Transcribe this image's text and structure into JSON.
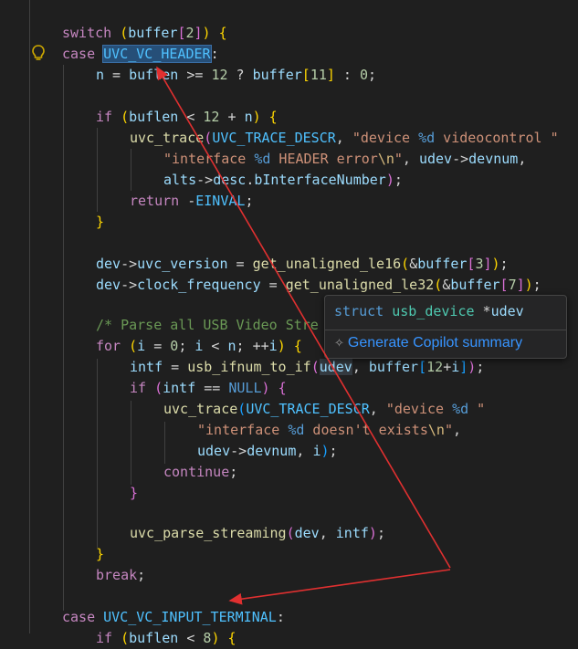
{
  "code": {
    "l1": {
      "a": "switch",
      "b": "(",
      "c": "buffer",
      "d": "[",
      "e": "2",
      "f": "]",
      "g": ")",
      "h": "{"
    },
    "l2": {
      "a": "case",
      "b": "UVC_VC_HEADER",
      "c": ":"
    },
    "l3": {
      "a": "n",
      "b": " = ",
      "c": "buflen",
      "d": " >= ",
      "e": "12",
      "f": " ? ",
      "g": "buffer",
      "h": "[",
      "i": "11",
      "j": "]",
      "k": " : ",
      "l": "0",
      "m": ";"
    },
    "l5": {
      "a": "if",
      "b": "(",
      "c": "buflen",
      "d": " < ",
      "e": "12",
      "f": " + ",
      "g": "n",
      "h": ")",
      "i": "{"
    },
    "l6": {
      "a": "uvc_trace",
      "b": "(",
      "c": "UVC_TRACE_DESCR",
      "d": ", ",
      "e": "\"device ",
      "f": "%d",
      "g": " videocontrol \""
    },
    "l7": {
      "a": "\"interface ",
      "b": "%d",
      "c": " HEADER error",
      "d": "\\n",
      "e": "\"",
      "f": ", ",
      "g": "udev",
      "h": "->",
      "i": "devnum",
      "j": ","
    },
    "l8": {
      "a": "alts",
      "b": "->",
      "c": "desc",
      "d": ".",
      "e": "bInterfaceNumber",
      "f": ")",
      "g": ";"
    },
    "l9": {
      "a": "return",
      "b": " -",
      "c": "EINVAL",
      "d": ";"
    },
    "l10": {
      "a": "}"
    },
    "l12": {
      "a": "dev",
      "b": "->",
      "c": "uvc_version",
      "d": " = ",
      "e": "get_unaligned_le16",
      "f": "(",
      "g": "&",
      "h": "buffer",
      "i": "[",
      "j": "3",
      "k": "]",
      "l": ")",
      "m": ";"
    },
    "l13": {
      "a": "dev",
      "b": "->",
      "c": "clock_frequency",
      "d": " = ",
      "e": "get_unaligned_le32",
      "f": "(",
      "g": "&",
      "h": "buffer",
      "i": "[",
      "j": "7",
      "k": "]",
      "l": ")",
      "m": ";"
    },
    "l15": {
      "a": "/* Parse all USB Video Stre"
    },
    "l16": {
      "a": "for",
      "b": "(",
      "c": "i",
      "d": " = ",
      "e": "0",
      "f": "; ",
      "g": "i",
      "h": " < ",
      "i": "n",
      "j": "; ++",
      "k": "i",
      "l": ")",
      "m": "{"
    },
    "l17": {
      "a": "intf",
      "b": " = ",
      "c": "usb_ifnum_to_if",
      "d": "(",
      "e": "udev",
      "f": ", ",
      "g": "buffer",
      "h": "[",
      "i": "12",
      "j": "+",
      "k": "i",
      "l": "]",
      "m": ")",
      "n": ";"
    },
    "l18": {
      "a": "if",
      "b": "(",
      "c": "intf",
      "d": " == ",
      "e": "NULL",
      "f": ")",
      "g": "{"
    },
    "l19": {
      "a": "uvc_trace",
      "b": "(",
      "c": "UVC_TRACE_DESCR",
      "d": ", ",
      "e": "\"device ",
      "f": "%d",
      "g": " \""
    },
    "l20": {
      "a": "\"interface ",
      "b": "%d",
      "c": " doesn't exists",
      "d": "\\n",
      "e": "\"",
      "f": ","
    },
    "l21": {
      "a": "udev",
      "b": "->",
      "c": "devnum",
      "d": ", ",
      "e": "i",
      "f": ")",
      "g": ";"
    },
    "l22": {
      "a": "continue",
      "b": ";"
    },
    "l23": {
      "a": "}"
    },
    "l25": {
      "a": "uvc_parse_streaming",
      "b": "(",
      "c": "dev",
      "d": ", ",
      "e": "intf",
      "f": ")",
      "g": ";"
    },
    "l26": {
      "a": "}"
    },
    "l27": {
      "a": "break",
      "b": ";"
    },
    "l29": {
      "a": "case",
      "b": "UVC_VC_INPUT_TERMINAL",
      "c": ":"
    },
    "l30": {
      "a": "if",
      "b": "(",
      "c": "buflen",
      "d": " < ",
      "e": "8",
      "f": ")",
      "g": "{"
    }
  },
  "hover": {
    "kw": "struct",
    "type": "usb_device",
    "ptr": " *",
    "name": "udev",
    "action_label": "Generate Copilot summary",
    "action_icon": "sparkle-icon"
  },
  "lightbulb": {
    "icon": "lightbulb-icon",
    "color": "#cca700"
  },
  "annotation": {
    "color": "#e03030"
  }
}
